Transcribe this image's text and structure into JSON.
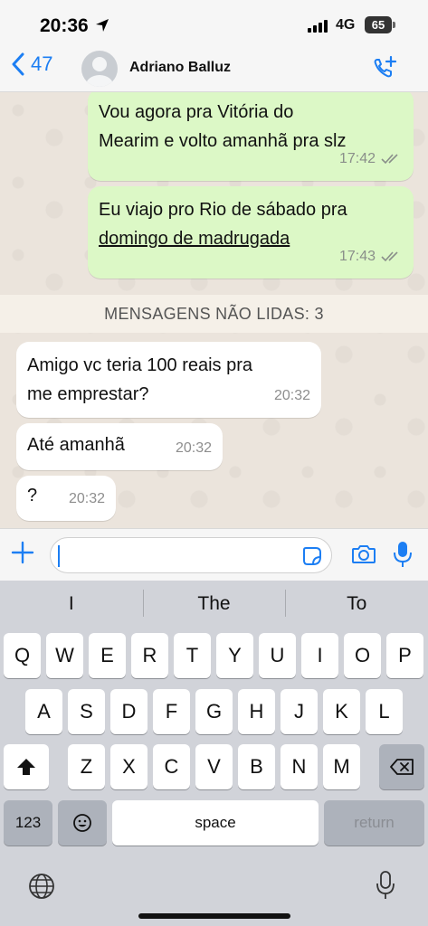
{
  "status_bar": {
    "time": "20:36",
    "network": "4G",
    "battery": "65"
  },
  "header": {
    "back_count": "47",
    "contact_name": "Adriano Balluz"
  },
  "messages_out": [
    {
      "text_line1": "Vou agora pra Vitória do",
      "text_line2": "Mearim e volto amanhã pra slz",
      "time": "17:42"
    },
    {
      "text_line1": "Eu viajo pro Rio de sábado pra",
      "text_line2": "domingo de madrugada",
      "time": "17:43"
    }
  ],
  "unread_banner": "MENSAGENS NÃO LIDAS: 3",
  "messages_in": [
    {
      "text_line1": "Amigo vc teria 100 reais pra",
      "text_line2": "me emprestar?",
      "time": "20:32"
    },
    {
      "text": "Até amanhã",
      "time": "20:32"
    },
    {
      "text": "?",
      "time": "20:32"
    }
  ],
  "composer": {
    "value": ""
  },
  "keyboard": {
    "suggestions": [
      "I",
      "The",
      "To"
    ],
    "row1": [
      "Q",
      "W",
      "E",
      "R",
      "T",
      "Y",
      "U",
      "I",
      "O",
      "P"
    ],
    "row2": [
      "A",
      "S",
      "D",
      "F",
      "G",
      "H",
      "J",
      "K",
      "L"
    ],
    "row3": [
      "Z",
      "X",
      "C",
      "V",
      "B",
      "N",
      "M"
    ],
    "numbers_key": "123",
    "space_key": "space",
    "return_key": "return"
  },
  "colors": {
    "accent": "#1c7ef3",
    "outgoing_bubble": "#dcf8c6",
    "incoming_bubble": "#ffffff",
    "chat_bg": "#ebe4dc"
  },
  "icons": [
    "location-arrow-icon",
    "back-chevron-icon",
    "avatar-icon",
    "add-call-icon",
    "double-check-icon",
    "plus-icon",
    "sticker-icon",
    "camera-icon",
    "mic-icon",
    "shift-icon",
    "backspace-icon",
    "emoji-icon",
    "globe-icon"
  ]
}
